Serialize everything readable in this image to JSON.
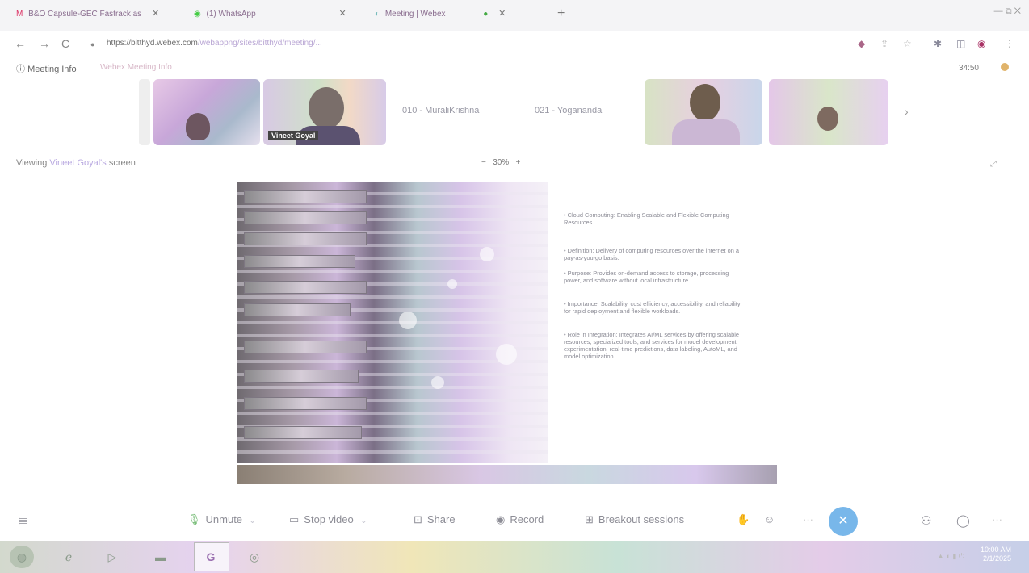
{
  "browser": {
    "tabs": [
      {
        "title": "B&O Capsule-GEC Fastrack as",
        "icon": "mail-icon"
      },
      {
        "title": "(1) WhatsApp",
        "icon": "whatsapp-icon"
      },
      {
        "title": "Meeting | Webex",
        "icon": "webex-icon"
      }
    ],
    "new_tab": "+",
    "window_controls": "— ⧉ ✕",
    "nav": {
      "back": "←",
      "forward": "→",
      "reload": "C"
    },
    "url_host": "https://bitthyd.webex.com",
    "url_rest": "/webappng/sites/bitthyd/meeting/..."
  },
  "meeting": {
    "info_label": "Meeting Info",
    "info_sub": "Webex Meeting Info",
    "timer": "34:50",
    "participants": [
      {
        "name": "",
        "video": true
      },
      {
        "name": "Vineet Goyal",
        "video": true
      },
      {
        "name": "010 - MuraliKrishna",
        "video": false
      },
      {
        "name": "021 - Yogananda",
        "video": false
      },
      {
        "name": "",
        "video": true
      },
      {
        "name": "",
        "video": true
      }
    ],
    "viewing_prefix": "Viewing",
    "viewing_name": "Vineet Goyal's",
    "viewing_suffix": "screen",
    "zoom": "30%",
    "zoom_minus": "−",
    "zoom_plus": "+"
  },
  "slide": {
    "title_bullet": "•  Cloud Computing: Enabling Scalable and Flexible Computing Resources",
    "bullets": [
      "•  Definition: Delivery of computing resources over the internet on a pay-as-you-go basis.",
      "•  Purpose: Provides on-demand access to storage, processing power, and software without local infrastructure.",
      "•  Importance: Scalability, cost efficiency, accessibility, and reliability for rapid deployment and flexible workloads.",
      "•  Role in Integration: Integrates AI/ML services by offering scalable resources, specialized tools, and services for model development, experimentation, real-time predictions, data labeling, AutoML, and model optimization."
    ]
  },
  "controls": {
    "unmute": "Unmute",
    "stop_video": "Stop video",
    "share": "Share",
    "record": "Record",
    "breakout": "Breakout sessions",
    "leave": "✕"
  },
  "taskbar": {
    "clock_time": "10:00 AM",
    "clock_date": "2/1/2025"
  }
}
